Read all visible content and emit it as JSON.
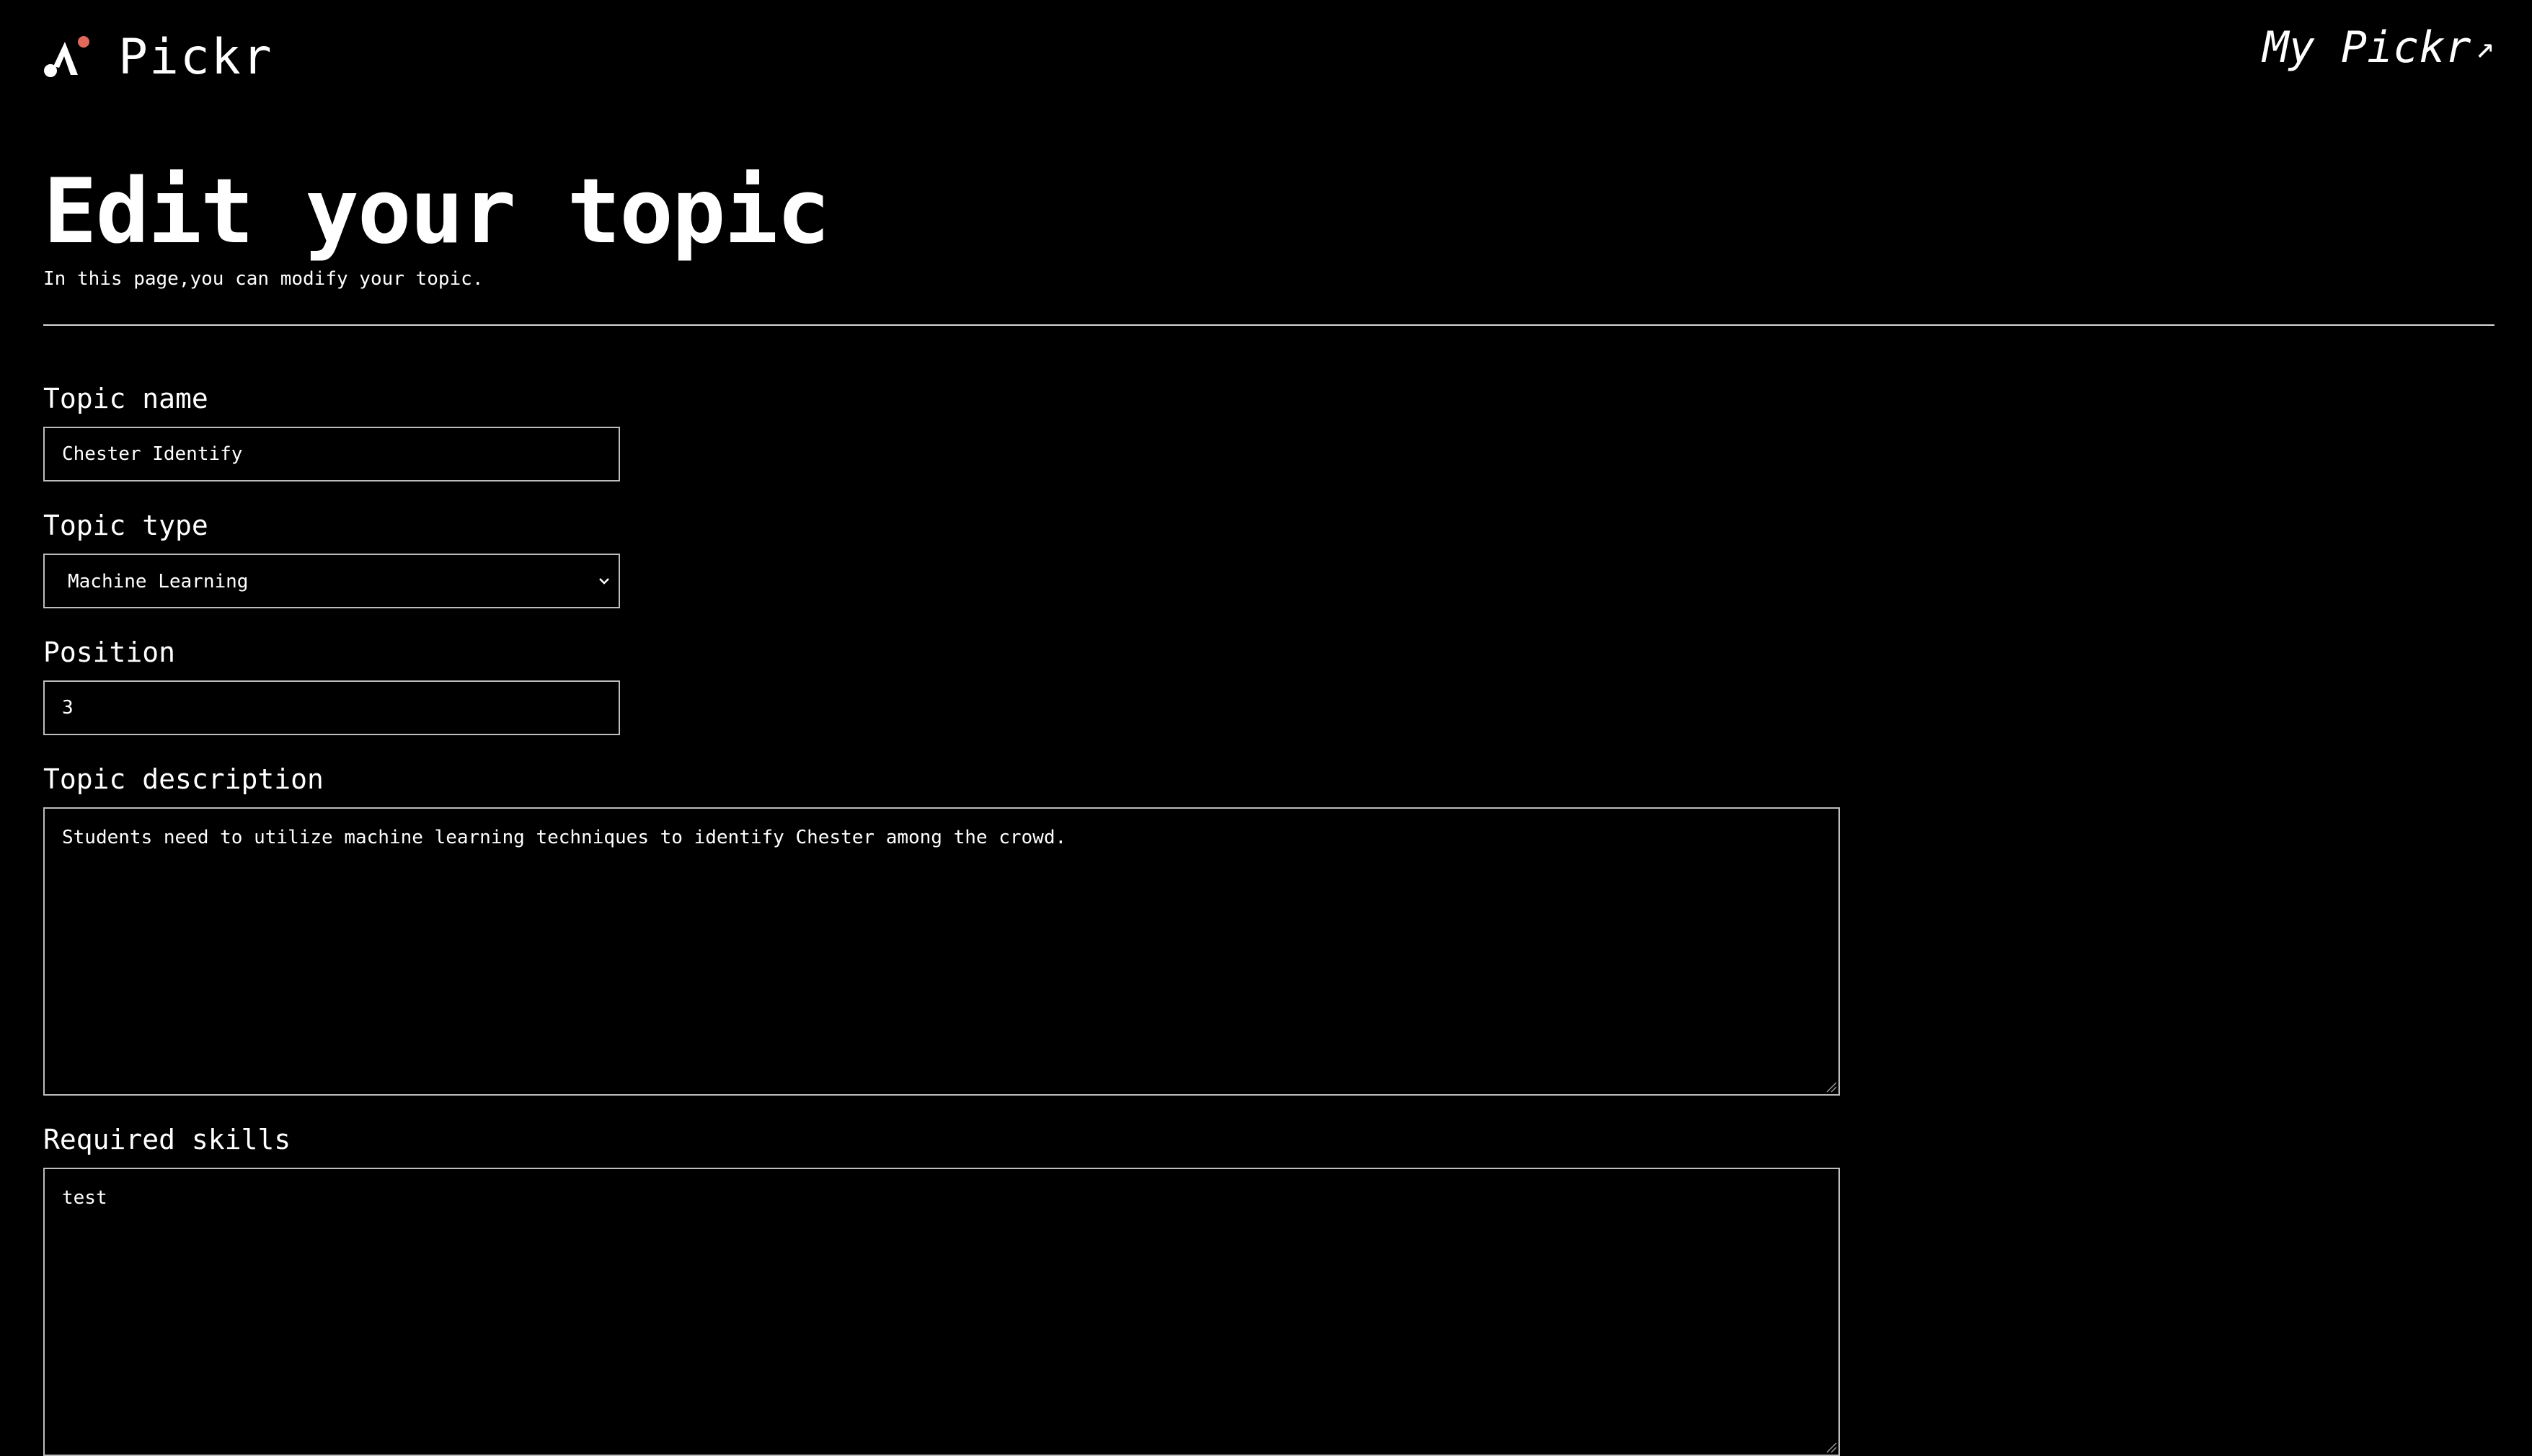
{
  "header": {
    "brand": "Pickr",
    "my_pickr_label": "My Pickr",
    "my_pickr_arrow": "↗",
    "accent_color": "#e0695a"
  },
  "page": {
    "title": "Edit your topic",
    "subtitle": "In this page,you can modify your topic."
  },
  "form": {
    "topic_name": {
      "label": "Topic name",
      "value": "Chester Identify"
    },
    "topic_type": {
      "label": "Topic type",
      "selected": "Machine Learning"
    },
    "position": {
      "label": "Position",
      "value": "3"
    },
    "description": {
      "label": "Topic description",
      "value": "Students need to utilize machine learning techniques to identify Chester among the crowd."
    },
    "skills": {
      "label": "Required skills",
      "value": "test"
    }
  }
}
